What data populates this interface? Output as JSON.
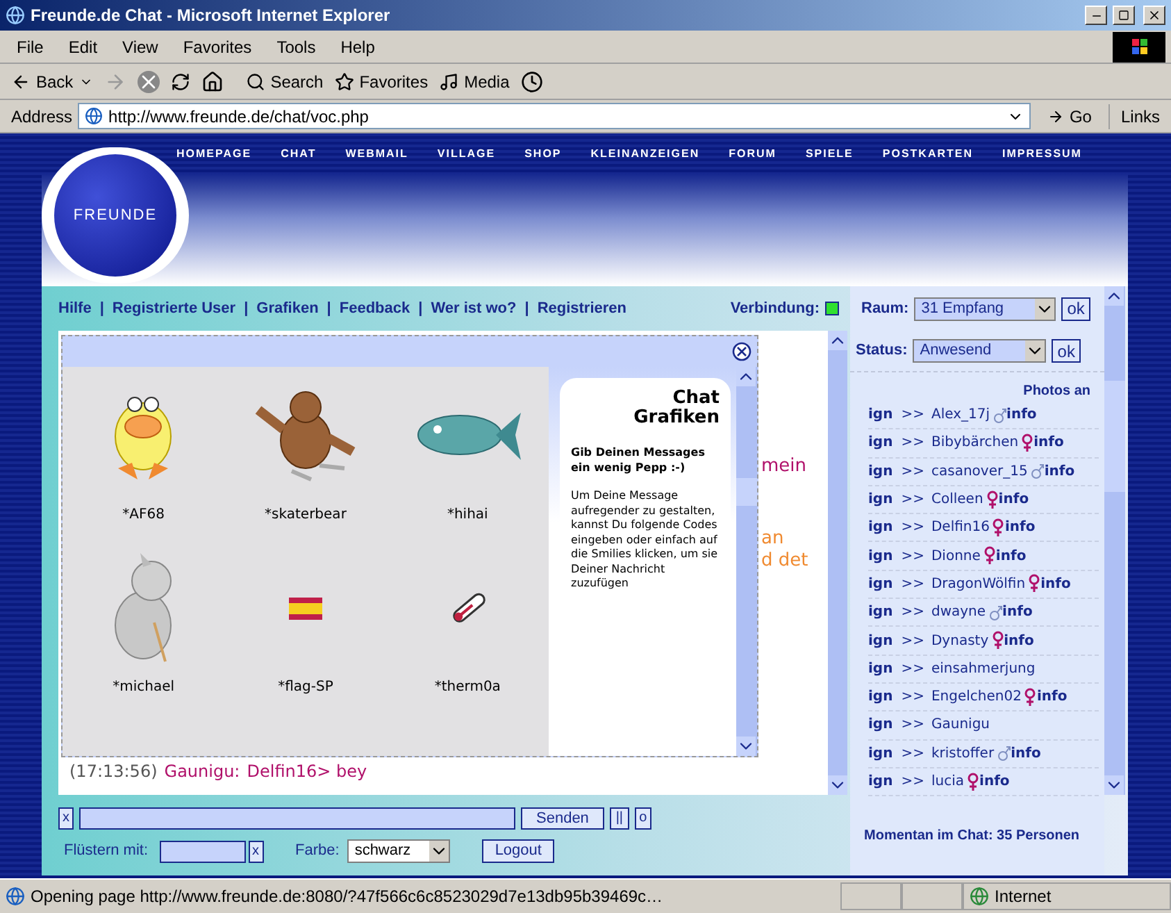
{
  "window": {
    "title": "Freunde.de Chat - Microsoft Internet Explorer"
  },
  "menu": [
    "File",
    "Edit",
    "View",
    "Favorites",
    "Tools",
    "Help"
  ],
  "toolbar": {
    "back": "Back",
    "search": "Search",
    "favorites": "Favorites",
    "media": "Media"
  },
  "address": {
    "label": "Address",
    "url": "http://www.freunde.de/chat/voc.php",
    "go": "Go",
    "links": "Links"
  },
  "nav": [
    "HOMEPAGE",
    "CHAT",
    "WEBMAIL",
    "VILLAGE",
    "SHOP",
    "KLEINANZEIGEN",
    "FORUM",
    "SPIELE",
    "POSTKARTEN",
    "IMPRESSUM"
  ],
  "logo": "FREUNDE",
  "chat_links": [
    {
      "label": "Hilfe"
    },
    {
      "separator": "|",
      "label": "Registrierte User"
    },
    {
      "separator": "|",
      "label": "Grafiken"
    },
    {
      "separator": "|",
      "label": "Feedback"
    },
    {
      "separator": "|",
      "label": "Wer ist wo?"
    },
    {
      "separator": "|",
      "label": "Registrieren"
    }
  ],
  "connection": {
    "label": "Verbindung:",
    "connected": true
  },
  "room": {
    "label": "Raum:",
    "value": "31 Empfang",
    "ok": "ok"
  },
  "status": {
    "label": "Status:",
    "value": "Anwesend",
    "ok": "ok"
  },
  "graphics_popup": {
    "title": "Chat Grafiken",
    "heading": "Gib Deinen Messages ein wenig Pepp :-)",
    "body": "Um Deine Message aufregender zu gestalten, kannst Du folgende Codes eingeben oder einfach auf die Smilies klicken, um sie Deiner Nachricht zuzufügen",
    "smilies": [
      {
        "kind": "duck",
        "code": "*AF68"
      },
      {
        "kind": "bear",
        "code": "*skaterbear"
      },
      {
        "kind": "fish",
        "code": "*hihai"
      },
      {
        "kind": "wolf",
        "code": "*michael"
      },
      {
        "kind": "flag",
        "code": "*flag-SP"
      },
      {
        "kind": "thermometer",
        "code": "*therm0a"
      }
    ]
  },
  "chat_fragments": [
    {
      "text": "mein",
      "color": "#b0106a"
    },
    {
      "text": "an",
      "color": "#f08a30"
    },
    {
      "text": "d det",
      "color": "#f08a30"
    }
  ],
  "last_message": {
    "time": "(17:13:56)",
    "nick": "Gaunigu:",
    "text": "Delfin16> bey"
  },
  "photos": "Photos an",
  "users": [
    {
      "prefix": "ign",
      "arrow": ">>",
      "name": "Alex_17j",
      "kind": "male",
      "info": "info"
    },
    {
      "prefix": "ign",
      "arrow": ">>",
      "name": "Bibybärchen",
      "kind": "female",
      "info": "info"
    },
    {
      "prefix": "ign",
      "arrow": ">>",
      "name": "casanover_15",
      "kind": "male",
      "info": "info"
    },
    {
      "prefix": "ign",
      "arrow": ">>",
      "name": "Colleen",
      "kind": "female",
      "info": "info"
    },
    {
      "prefix": "ign",
      "arrow": ">>",
      "name": "Delfin16",
      "kind": "female",
      "info": "info"
    },
    {
      "prefix": "ign",
      "arrow": ">>",
      "name": "Dionne",
      "kind": "female",
      "info": "info"
    },
    {
      "prefix": "ign",
      "arrow": ">>",
      "name": "DragonWölfin",
      "kind": "female",
      "info": "info"
    },
    {
      "prefix": "ign",
      "arrow": ">>",
      "name": "dwayne",
      "kind": "male",
      "info": "info"
    },
    {
      "prefix": "ign",
      "arrow": ">>",
      "name": "Dynasty",
      "kind": "female",
      "info": "info"
    },
    {
      "prefix": "ign",
      "arrow": ">>",
      "name": "einsahmerjung"
    },
    {
      "prefix": "ign",
      "arrow": ">>",
      "name": "Engelchen02",
      "kind": "female",
      "info": "info"
    },
    {
      "prefix": "ign",
      "arrow": ">>",
      "name": "Gaunigu"
    },
    {
      "prefix": "ign",
      "arrow": ">>",
      "name": "kristoffer",
      "kind": "male",
      "info": "info"
    },
    {
      "prefix": "ign",
      "arrow": ">>",
      "name": "lucia",
      "kind": "female",
      "info": "info"
    }
  ],
  "online_count": "Momentan im Chat: 35 Personen",
  "input": {
    "clear": "x",
    "send": "Senden",
    "pause": "||",
    "other": "o"
  },
  "whisper": {
    "label": "Flüstern mit:",
    "clear": "x"
  },
  "color_select": {
    "label": "Farbe:",
    "value": "schwarz"
  },
  "logout": "Logout",
  "status_bar": {
    "text": "Opening page http://www.freunde.de:8080/?47f566c6c8523029d7e13db95b39469c…",
    "zone": "Internet"
  }
}
